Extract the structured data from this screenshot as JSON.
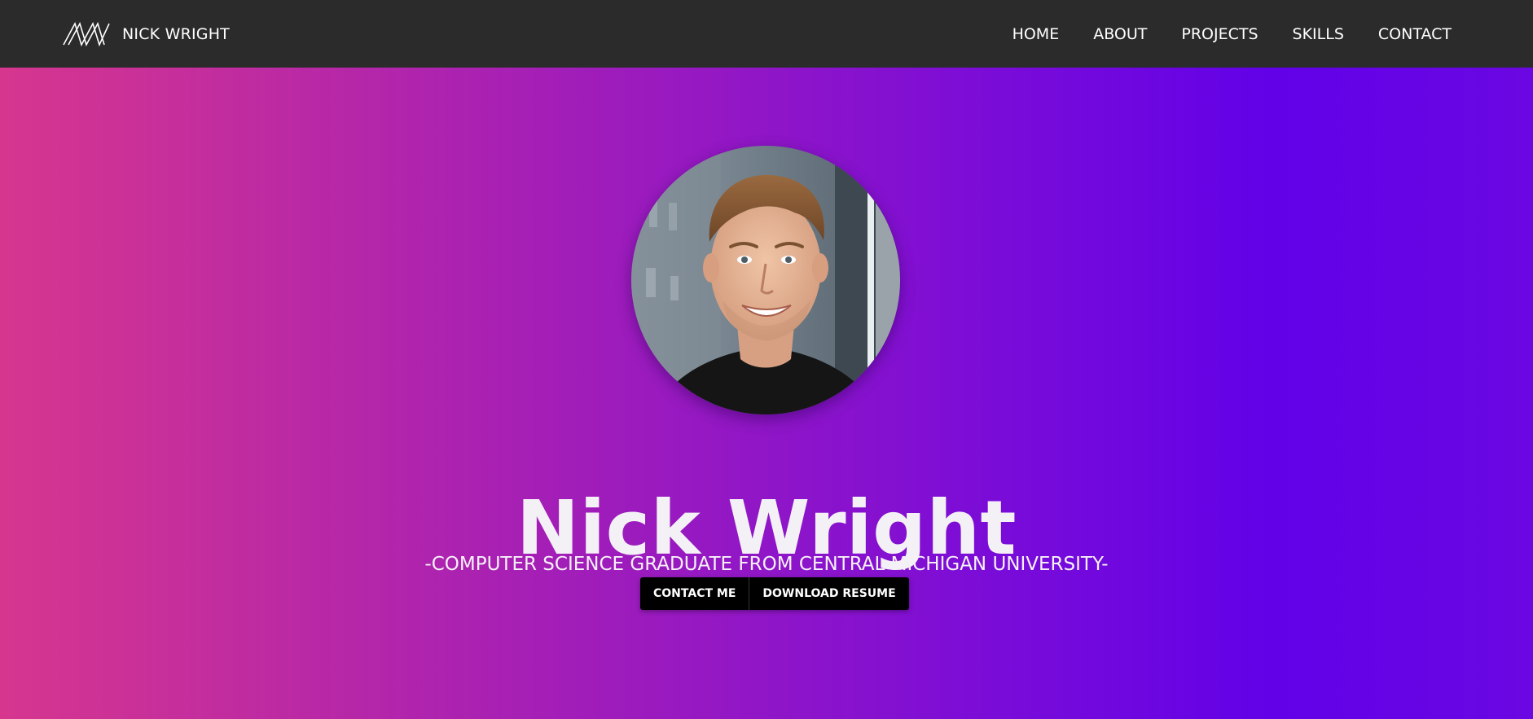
{
  "nav": {
    "brand_name": "NICK WRIGHT",
    "links": [
      {
        "label": "HOME"
      },
      {
        "label": "ABOUT"
      },
      {
        "label": "PROJECTS"
      },
      {
        "label": "SKILLS"
      },
      {
        "label": "CONTACT"
      }
    ]
  },
  "hero": {
    "name": "Nick Wright",
    "tagline": "-COMPUTER SCIENCE GRADUATE FROM CENTRAL MICHIGAN UNIVERSITY-",
    "buttons": {
      "contact_label": "CONTACT ME",
      "resume_label": "DOWNLOAD RESUME"
    }
  },
  "colors": {
    "navbar_bg": "#2b2b2b",
    "gradient_start": "#d6368e",
    "gradient_end": "#6201e8",
    "button_bg": "#000000"
  },
  "icons": {
    "brand": "nw-monogram-logo"
  }
}
